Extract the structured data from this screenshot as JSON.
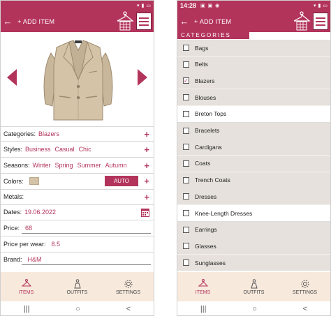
{
  "left": {
    "status": {
      "time": "",
      "icons": "",
      "battery": ""
    },
    "appbar": {
      "back": "←",
      "add_label": "+ ADD ITEM"
    },
    "form": {
      "categories": {
        "label": "Categories:",
        "values": [
          "Blazers"
        ]
      },
      "styles": {
        "label": "Styles:",
        "values": [
          "Business",
          "Casual",
          "Chic"
        ]
      },
      "seasons": {
        "label": "Seasons:",
        "values": [
          "Winter",
          "Spring",
          "Summer",
          "Autumn"
        ]
      },
      "colors": {
        "label": "Colors:",
        "swatch": "#d5c3a7",
        "auto_label": "AUTO"
      },
      "metals": {
        "label": "Metals:"
      },
      "dates": {
        "label": "Dates:",
        "value": "19.06.2022"
      },
      "price": {
        "label": "Price:",
        "value": "68"
      },
      "price_per_wear": {
        "label": "Price per wear:",
        "value": "8.5"
      },
      "brand": {
        "label": "Brand:",
        "value": "H&M"
      }
    }
  },
  "right": {
    "status": {
      "time": "14:28",
      "icons": "",
      "battery": ""
    },
    "appbar": {
      "back": "←",
      "add_label": "+ ADD ITEM"
    },
    "header": "CATEGORIES",
    "items": [
      {
        "label": "Bags",
        "checked": false
      },
      {
        "label": "Belts",
        "checked": false
      },
      {
        "label": "Blazers",
        "checked": true
      },
      {
        "label": "Blouses",
        "checked": false
      },
      {
        "label": "Breton Tops",
        "checked": false
      },
      {
        "label": "Bracelets",
        "checked": false
      },
      {
        "label": "Cardigans",
        "checked": false
      },
      {
        "label": "Coats",
        "checked": false
      },
      {
        "label": "Trench Coats",
        "checked": false
      },
      {
        "label": "Dresses",
        "checked": false
      },
      {
        "label": "Knee-Length Dresses",
        "checked": false
      },
      {
        "label": "Earrings",
        "checked": false
      },
      {
        "label": "Glasses",
        "checked": false
      },
      {
        "label": "Sunglasses",
        "checked": false
      }
    ]
  },
  "nav": {
    "items": "ITEMS",
    "outfits": "OUTFITS",
    "settings": "SETTINGS"
  },
  "sysnav": {
    "recents": "|||",
    "home": "○",
    "back": "<"
  },
  "colors": {
    "accent": "#b3345b",
    "nav_bg": "#f7e9dc",
    "list_bg": "#e6e1dc"
  }
}
